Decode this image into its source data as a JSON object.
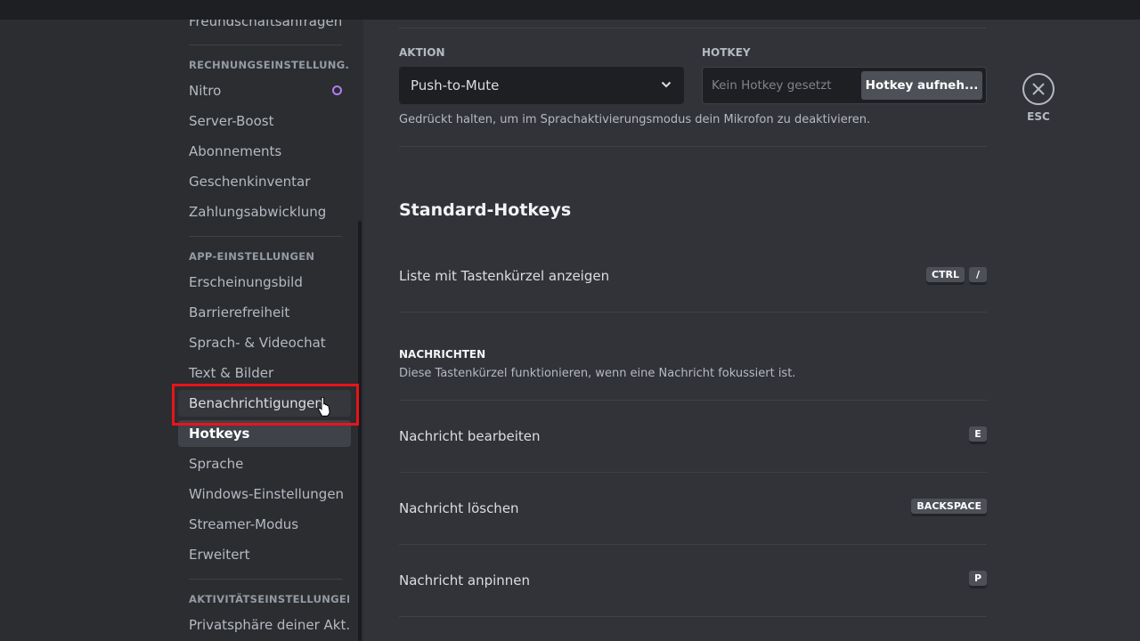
{
  "sidebar": {
    "items_top": [
      {
        "label": "Freundschaftsanfragen"
      }
    ],
    "billing": {
      "header": "RECHNUNGSEINSTELLUNG...",
      "items": [
        {
          "label": "Nitro"
        },
        {
          "label": "Server-Boost"
        },
        {
          "label": "Abonnements"
        },
        {
          "label": "Geschenkinventar"
        },
        {
          "label": "Zahlungsabwicklung"
        }
      ]
    },
    "app": {
      "header": "APP-EINSTELLUNGEN",
      "items": [
        {
          "label": "Erscheinungsbild"
        },
        {
          "label": "Barrierefreiheit"
        },
        {
          "label": "Sprach- & Videochat"
        },
        {
          "label": "Text & Bilder"
        },
        {
          "label": "Benachrichtigungen"
        },
        {
          "label": "Hotkeys"
        },
        {
          "label": "Sprache"
        },
        {
          "label": "Windows-Einstellungen"
        },
        {
          "label": "Streamer-Modus"
        },
        {
          "label": "Erweitert"
        }
      ]
    },
    "activity": {
      "header": "AKTIVITÄTSEINSTELLUNGEN",
      "items": [
        {
          "label": "Privatsphäre deiner Akt..."
        }
      ]
    },
    "selected": "Hotkeys",
    "hovered": "Benachrichtigungen"
  },
  "main": {
    "action_label": "AKTION",
    "action_value": "Push-to-Mute",
    "hotkey_label": "HOTKEY",
    "hotkey_placeholder": "Kein Hotkey gesetzt",
    "hotkey_button": "Hotkey aufneh...",
    "hint": "Gedrückt halten, um im Sprachaktivierungsmodus dein Mikrofon zu deaktivieren.",
    "standard_title": "Standard-Hotkeys",
    "shortcut_list": {
      "label": "Liste mit Tastenkürzel anzeigen",
      "keys": [
        "CTRL",
        "/"
      ]
    },
    "messages": {
      "header": "NACHRICHTEN",
      "description": "Diese Tastenkürzel funktionieren, wenn eine Nachricht fokussiert ist.",
      "rows": [
        {
          "label": "Nachricht bearbeiten",
          "key": "E"
        },
        {
          "label": "Nachricht löschen",
          "key": "BACKSPACE"
        },
        {
          "label": "Nachricht anpinnen",
          "key": "P"
        }
      ]
    }
  },
  "close": {
    "label": "ESC",
    "icon": "close-icon"
  },
  "colors": {
    "background": "#313338",
    "sidebar": "#2b2d31",
    "selected": "#404249",
    "highlight": "#e8141a",
    "nitro": "#b37cf5"
  }
}
